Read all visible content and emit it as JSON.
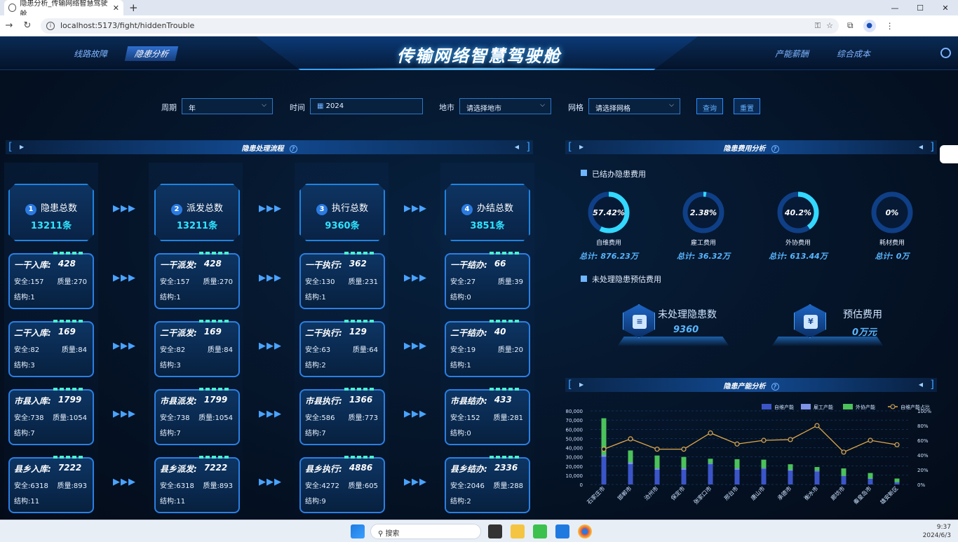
{
  "browser": {
    "tab_title": "隐患分析_传输网络智慧驾驶舱",
    "url": "localhost:5173/fight/hiddenTrouble"
  },
  "header": {
    "title": "传输网络智慧驾驶舱",
    "nav_left": [
      "线路故障",
      "隐患分析"
    ],
    "nav_right": [
      "产能薪酬",
      "综合成本"
    ],
    "active": "隐患分析"
  },
  "filters": {
    "period_label": "周期",
    "period_value": "年",
    "time_label": "时间",
    "time_value": "2024",
    "city_label": "地市",
    "city_value": "请选择地市",
    "grid_label": "网格",
    "grid_value": "请选择网格",
    "query": "查询",
    "reset": "重置"
  },
  "flow": {
    "title": "隐患处理流程",
    "heads": [
      {
        "num": "1",
        "label": "隐患总数",
        "value": "13211条"
      },
      {
        "num": "2",
        "label": "派发总数",
        "value": "13211条"
      },
      {
        "num": "3",
        "label": "执行总数",
        "value": "9360条"
      },
      {
        "num": "4",
        "label": "办结总数",
        "value": "3851条"
      }
    ],
    "labels": {
      "safety": "安全:",
      "quality": "质量:",
      "structure": "结构:"
    },
    "columns": [
      [
        {
          "name": "一干入库:",
          "total": "428",
          "safety": "157",
          "quality": "270",
          "structure": "1"
        },
        {
          "name": "二干入库:",
          "total": "169",
          "safety": "82",
          "quality": "84",
          "structure": "3"
        },
        {
          "name": "市县入库:",
          "total": "1799",
          "safety": "738",
          "quality": "1054",
          "structure": "7"
        },
        {
          "name": "县乡入库:",
          "total": "7222",
          "safety": "6318",
          "quality": "893",
          "structure": "11"
        }
      ],
      [
        {
          "name": "一干派发:",
          "total": "428",
          "safety": "157",
          "quality": "270",
          "structure": "1"
        },
        {
          "name": "二干派发:",
          "total": "169",
          "safety": "82",
          "quality": "84",
          "structure": "3"
        },
        {
          "name": "市县派发:",
          "total": "1799",
          "safety": "738",
          "quality": "1054",
          "structure": "7"
        },
        {
          "name": "县乡派发:",
          "total": "7222",
          "safety": "6318",
          "quality": "893",
          "structure": "11"
        }
      ],
      [
        {
          "name": "一干执行:",
          "total": "362",
          "safety": "130",
          "quality": "231",
          "structure": "1"
        },
        {
          "name": "二干执行:",
          "total": "129",
          "safety": "63",
          "quality": "64",
          "structure": "2"
        },
        {
          "name": "市县执行:",
          "total": "1366",
          "safety": "586",
          "quality": "773",
          "structure": "7"
        },
        {
          "name": "县乡执行:",
          "total": "4886",
          "safety": "4272",
          "quality": "605",
          "structure": "9"
        }
      ],
      [
        {
          "name": "一干结办:",
          "total": "66",
          "safety": "27",
          "quality": "39",
          "structure": "0"
        },
        {
          "name": "二干结办:",
          "total": "40",
          "safety": "19",
          "quality": "20",
          "structure": "1"
        },
        {
          "name": "市县结办:",
          "total": "433",
          "safety": "152",
          "quality": "281",
          "structure": "0"
        },
        {
          "name": "县乡结办:",
          "total": "2336",
          "safety": "2046",
          "quality": "288",
          "structure": "2"
        }
      ]
    ]
  },
  "cost": {
    "title": "隐患费用分析",
    "settled_title": "已结办隐患费用",
    "donuts": [
      {
        "pct": "57.42%",
        "ratio": 0.5742,
        "label": "自维费用",
        "total": "总计: 876.23万"
      },
      {
        "pct": "2.38%",
        "ratio": 0.0238,
        "label": "雇工费用",
        "total": "总计: 36.32万"
      },
      {
        "pct": "40.2%",
        "ratio": 0.402,
        "label": "外协费用",
        "total": "总计: 613.44万"
      },
      {
        "pct": "0%",
        "ratio": 0,
        "label": "耗材费用",
        "total": "总计: 0万"
      }
    ],
    "pending_title": "未处理隐患预估费用",
    "pending_count_label": "未处理隐患数",
    "pending_count": "9360",
    "est_label": "预估费用",
    "est_value": "0万元"
  },
  "capacity": {
    "title": "隐患产能分析"
  },
  "chart_data": {
    "type": "bar",
    "title": "隐患产能分析",
    "categories": [
      "石家庄市",
      "邯郸市",
      "沧州市",
      "保定市",
      "张家口市",
      "邢台市",
      "唐山市",
      "承德市",
      "衡水市",
      "廊坊市",
      "秦皇岛市",
      "雄安新区"
    ],
    "series": [
      {
        "name": "自维产能",
        "type": "bar",
        "stack": "a",
        "values": [
          30000,
          22000,
          16000,
          16000,
          22000,
          16000,
          17000,
          15000,
          14000,
          9000,
          6000,
          2000
        ]
      },
      {
        "name": "雇工产能",
        "type": "bar",
        "stack": "a",
        "values": [
          2000,
          2000,
          1500,
          2000,
          1000,
          1500,
          1000,
          1000,
          1000,
          500,
          500,
          500
        ]
      },
      {
        "name": "外协产能",
        "type": "bar",
        "stack": "a",
        "values": [
          40000,
          13000,
          14000,
          12000,
          5000,
          10000,
          9000,
          6000,
          4000,
          8000,
          6000,
          4000
        ]
      },
      {
        "name": "自维产能占比",
        "type": "line",
        "axis": "right",
        "values": [
          48,
          62,
          48,
          48,
          70,
          55,
          60,
          61,
          80,
          44,
          60,
          54
        ]
      }
    ],
    "ylim": [
      0,
      80000
    ],
    "y_ticks": [
      "0",
      "10,000",
      "20,000",
      "30,000",
      "40,000",
      "50,000",
      "60,000",
      "70,000",
      "80,000"
    ],
    "y2_ticks": [
      "0%",
      "20%",
      "40%",
      "60%",
      "80%",
      "100%"
    ],
    "colors": {
      "自维产能": "#3b55c9",
      "雇工产能": "#7f93e8",
      "外协产能": "#4bc25a",
      "自维产能占比": "#e0a94a"
    },
    "legend": "top-right"
  },
  "taskbar": {
    "search": "搜索",
    "time": "9:37",
    "date": "2024/6/3"
  }
}
